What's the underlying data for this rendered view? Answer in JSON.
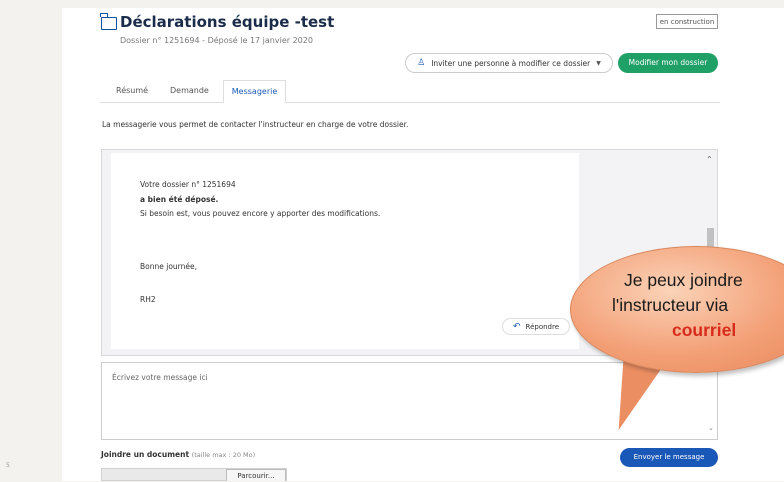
{
  "header": {
    "title": "Déclarations équipe -test",
    "subtitle": "Dossier n° 1251694 - Déposé le 17 janvier 2020",
    "status_badge": "en construction",
    "invite_button": "Inviter une personne à modifier ce dossier",
    "modify_button": "Modifier mon dossier"
  },
  "tabs": [
    {
      "label": "Résumé",
      "active": false
    },
    {
      "label": "Demande",
      "active": false
    },
    {
      "label": "Messagerie",
      "active": true
    }
  ],
  "intro_text": "La messagerie vous permet de contacter l'instructeur en charge de votre dossier.",
  "message": {
    "lines": [
      "Votre dossier n° 1251694",
      "a bien été déposé.",
      "Si besoin est, vous pouvez encore y apporter des modifications.",
      "Bonne journée,",
      "RH2"
    ],
    "reply_button": "Répondre"
  },
  "composer": {
    "placeholder": "Écrivez votre message ici",
    "attach_label": "Joindre un document",
    "attach_hint": "(taille max : 20 Mo)",
    "browse_button": "Parcourir...",
    "send_button": "Envoyer le message"
  },
  "side_number": "5",
  "callout": {
    "line1": "Je peux joindre",
    "line2": "l'instructeur via",
    "line3": "courriel"
  },
  "colors": {
    "primary_blue": "#1a58b8",
    "green": "#1fa067",
    "callout_orange": "#f3a077",
    "callout_red": "#d92b1c"
  },
  "icons": {
    "folder": "folder-icon",
    "user": "user-add-icon",
    "reply": "reply-icon",
    "caret": "chevron-down-icon"
  }
}
